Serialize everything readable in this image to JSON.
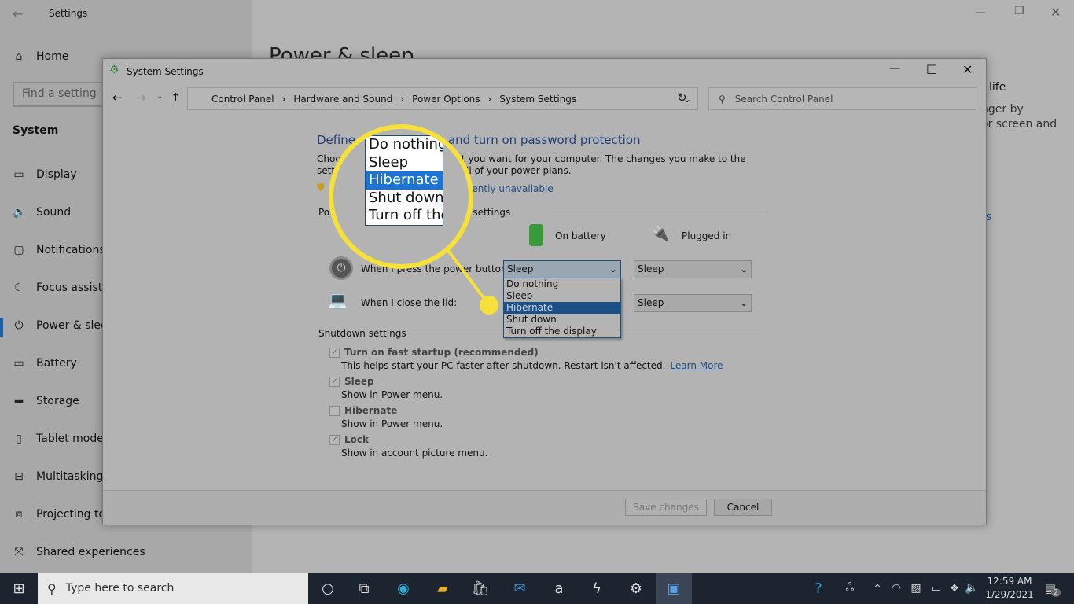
{
  "settings": {
    "title": "Settings",
    "home": "Home",
    "search_placeholder": "Find a setting",
    "section": "System",
    "nav": [
      {
        "label": "Display",
        "icon": "monitor-icon"
      },
      {
        "label": "Sound",
        "icon": "speaker-icon"
      },
      {
        "label": "Notifications & actions",
        "icon": "notification-icon"
      },
      {
        "label": "Focus assist",
        "icon": "moon-icon"
      },
      {
        "label": "Power & sleep",
        "icon": "power-icon"
      },
      {
        "label": "Battery",
        "icon": "battery-icon"
      },
      {
        "label": "Storage",
        "icon": "storage-icon"
      },
      {
        "label": "Tablet mode",
        "icon": "tablet-icon"
      },
      {
        "label": "Multitasking",
        "icon": "multitasking-icon"
      },
      {
        "label": "Projecting to this PC",
        "icon": "projecting-icon"
      },
      {
        "label": "Shared experiences",
        "icon": "shared-icon"
      }
    ],
    "page_title": "Power & sleep",
    "right_fragments": [
      "life",
      "nger by",
      "or screen and",
      "s"
    ]
  },
  "dialog": {
    "title": "System Settings",
    "breadcrumb": [
      "Control Panel",
      "Hardware and Sound",
      "Power Options",
      "System Settings"
    ],
    "search_placeholder": "Search Control Panel",
    "heading": "Define power buttons and turn on password protection",
    "description": "Choose the power settings that you want for your computer. The changes you make to the settings on this page apply to all of your power plans.",
    "admin_link": "Change settings that are currently unavailable",
    "power_group": "Power and sleep buttons and lid settings",
    "on_battery": "On battery",
    "plugged_in": "Plugged in",
    "rows": [
      {
        "label": "When I press the power button:",
        "battery": "Sleep",
        "plugged": "Sleep"
      },
      {
        "label": "When I close the lid:",
        "battery": "Sleep",
        "plugged": "Sleep"
      }
    ],
    "dropdown_options": [
      "Do nothing",
      "Sleep",
      "Hibernate",
      "Shut down",
      "Turn off the display"
    ],
    "dropdown_selected": "Hibernate",
    "shutdown_group": "Shutdown settings",
    "checkboxes": [
      {
        "label": "Turn on fast startup (recommended)",
        "desc": "This helps start your PC faster after shutdown. Restart isn't affected.",
        "link": "Learn More",
        "checked": true
      },
      {
        "label": "Sleep",
        "desc": "Show in Power menu.",
        "checked": true
      },
      {
        "label": "Hibernate",
        "desc": "Show in Power menu.",
        "checked": false
      },
      {
        "label": "Lock",
        "desc": "Show in account picture menu.",
        "checked": true
      }
    ],
    "save": "Save changes",
    "cancel": "Cancel"
  },
  "taskbar": {
    "search_placeholder": "Type here to search",
    "time": "12:59 AM",
    "date": "1/29/2021",
    "notifications": "2"
  },
  "colors": {
    "highlight": "#1c4f86",
    "magnifier": "#f5e13a",
    "link": "#1f4f8a"
  }
}
